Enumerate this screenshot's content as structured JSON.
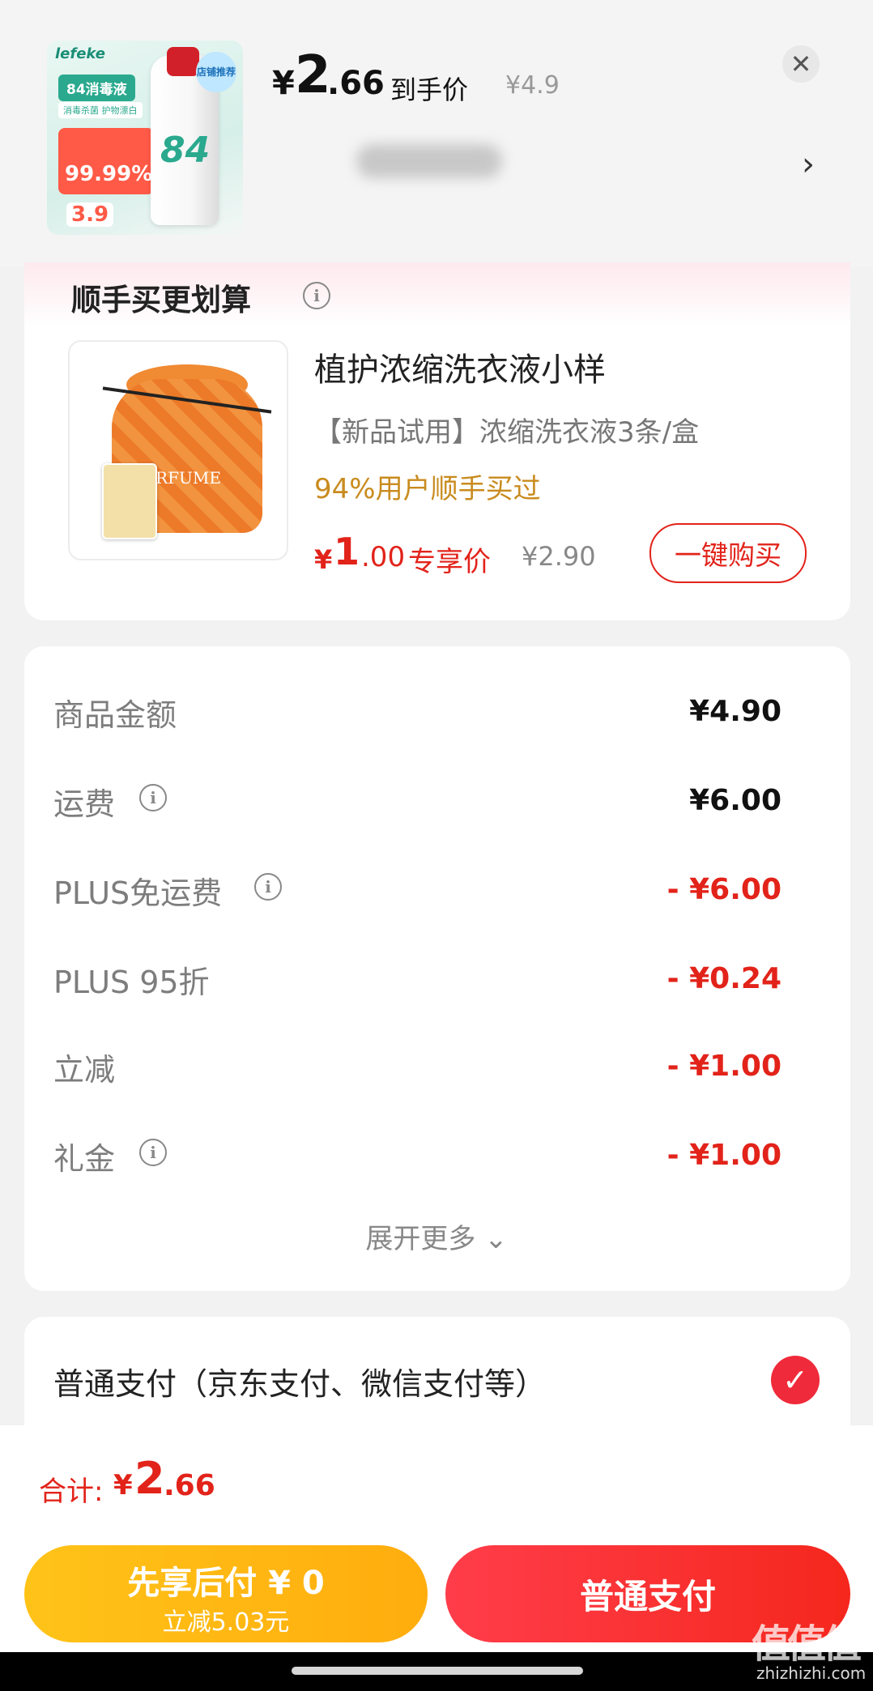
{
  "header": {
    "product_image_alt": "84消毒液",
    "thumb": {
      "brand": "lefeke",
      "tag": "84消毒液",
      "sub": "消毒杀菌 护物漂白",
      "price1": "99.99%",
      "price2": "3.9",
      "badge": "店铺推荐",
      "bottle_label": "84"
    },
    "price_yen": "¥",
    "price_int": "2",
    "price_dec": ".66",
    "price_label": "到手价",
    "orig_price": "¥4.9"
  },
  "addon": {
    "title": "顺手买更划算",
    "product": {
      "image_text": "PERFUME",
      "name": "植护浓缩洗衣液小样",
      "desc": "【新品试用】浓缩洗衣液3条/盒",
      "social": "94%用户顺手买过",
      "price_yen": "¥",
      "price_int": "1",
      "price_dec": ".00",
      "price_label": "专享价",
      "orig_price": "¥2.90",
      "buy_label": "一键购买"
    }
  },
  "summary": {
    "rows": [
      {
        "label": "商品金额",
        "value": "¥4.90",
        "info": false
      },
      {
        "label": "运费",
        "value": "¥6.00",
        "info": true
      },
      {
        "label": "PLUS免运费",
        "value": "- ¥6.00",
        "info": true
      },
      {
        "label": "PLUS 95折",
        "value": "- ¥0.24",
        "info": false
      },
      {
        "label": "立减",
        "value": "- ¥1.00",
        "info": false
      },
      {
        "label": "礼金",
        "value": "- ¥1.00",
        "info": true
      }
    ],
    "expand_label": "展开更多 ⌄"
  },
  "payment": {
    "method_label": "普通支付（京东支付、微信支付等）"
  },
  "footer": {
    "total_label": "合计:",
    "total_yen": "¥",
    "total_int": "2",
    "total_dec": ".66",
    "later_main": "先享后付 ¥ 0",
    "later_sub": "立减5.03元",
    "pay_label": "普通支付"
  },
  "watermark": {
    "main": "值值值",
    "sub": "zhizhizhi.com"
  },
  "colors": {
    "accent_red": "#e2231a",
    "gold": "#c98b1e",
    "later_yellow": "#ffb414"
  }
}
